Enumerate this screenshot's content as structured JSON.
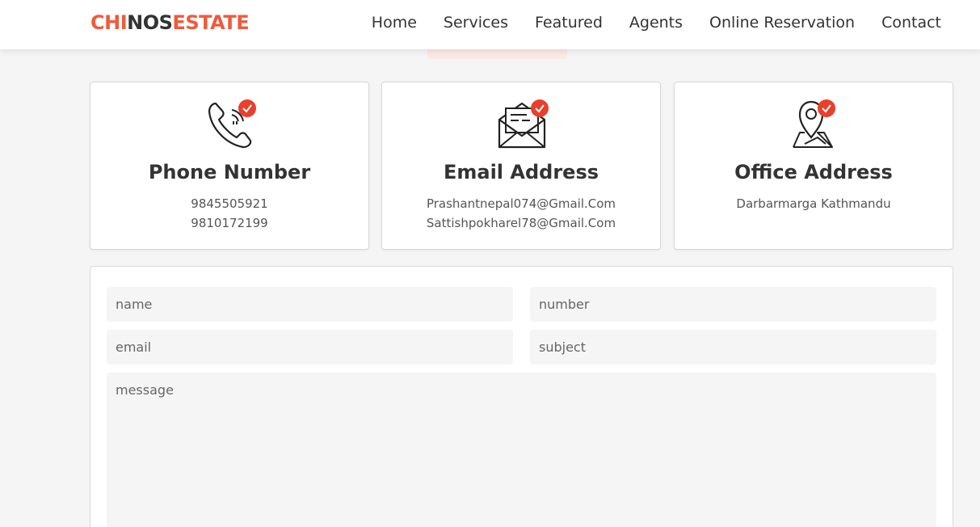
{
  "brand": {
    "part1": "CHI",
    "part2": "NOS",
    "part3": "ESTATE",
    "accent_color": "#f05a3c"
  },
  "nav": {
    "items": [
      "Home",
      "Services",
      "Featured",
      "Agents",
      "Online Reservation",
      "Contact"
    ]
  },
  "cards": [
    {
      "icon": "phone-icon",
      "title": "Phone Number",
      "lines": [
        "9845505921",
        "9810172199"
      ]
    },
    {
      "icon": "envelope-icon",
      "title": "Email Address",
      "lines": [
        "Prashantnepal074@Gmail.Com",
        "Sattishpokharel78@Gmail.Com"
      ]
    },
    {
      "icon": "map-pin-icon",
      "title": "Office Address",
      "lines": [
        "Darbarmarga Kathmandu"
      ]
    }
  ],
  "form": {
    "name_placeholder": "name",
    "number_placeholder": "number",
    "email_placeholder": "email",
    "subject_placeholder": "subject",
    "message_placeholder": "message"
  }
}
